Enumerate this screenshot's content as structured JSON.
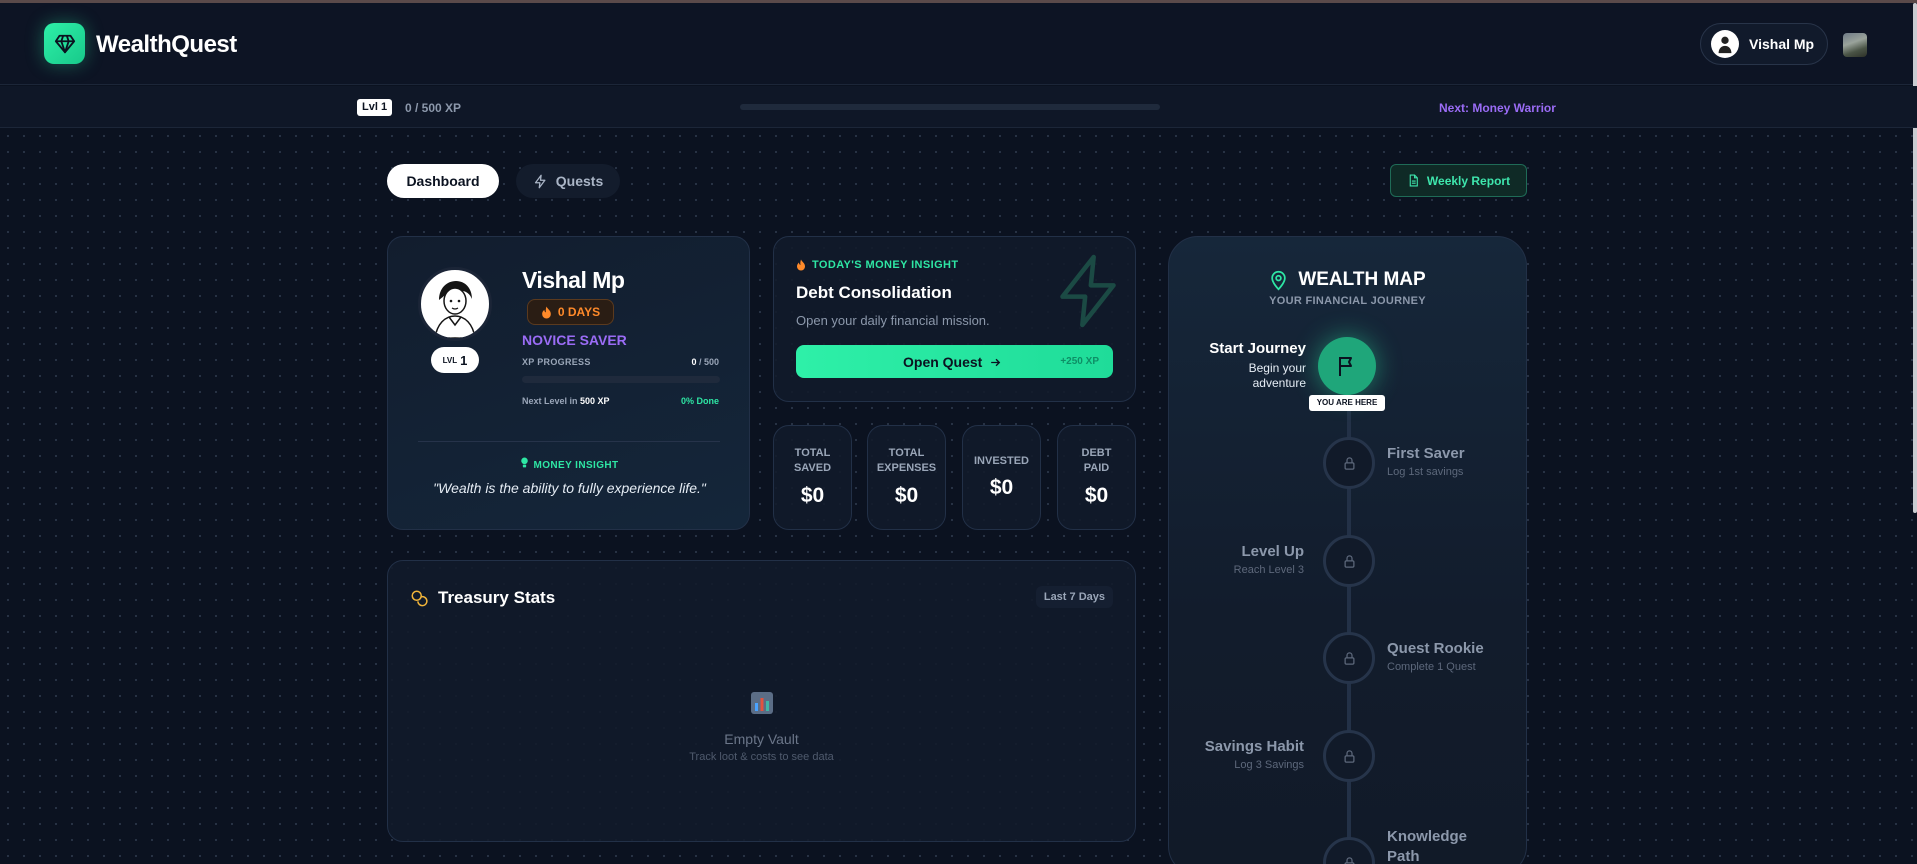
{
  "app": {
    "name": "WealthQuest"
  },
  "header": {
    "user_name": "Vishal Mp"
  },
  "xp_bar": {
    "level_chip": "Lvl 1",
    "xp_text": "0 / 500 XP",
    "progress": 0,
    "next_label": "Next: Money Warrior"
  },
  "tabs": [
    {
      "label": "Dashboard",
      "active": true
    },
    {
      "label": "Quests",
      "active": false
    }
  ],
  "weekly_report_label": "Weekly Report",
  "profile": {
    "name": "Vishal Mp",
    "streak": "0 DAYS",
    "rank": "NOVICE SAVER",
    "level_prefix": "LVL",
    "level": "1",
    "xp_label": "XP PROGRESS",
    "xp_current": "0",
    "xp_total": " / 500",
    "progress": 0,
    "next_level_prefix": "Next Level in ",
    "next_level_xp": "500 XP",
    "done": "0% Done",
    "insight_label": "MONEY INSIGHT",
    "quote": "\"Wealth is the ability to fully experience life.\""
  },
  "insight": {
    "label": "TODAY'S MONEY INSIGHT",
    "title": "Debt Consolidation",
    "subtitle": "Open your daily financial mission.",
    "button": "Open Quest",
    "xp": "+250 XP"
  },
  "stats": [
    {
      "label1": "TOTAL",
      "label2": "SAVED",
      "value": "$0"
    },
    {
      "label1": "TOTAL",
      "label2": "EXPENSES",
      "value": "$0"
    },
    {
      "label1": "INVESTED",
      "label2": "",
      "value": "$0"
    },
    {
      "label1": "DEBT",
      "label2": "PAID",
      "value": "$0"
    }
  ],
  "treasury": {
    "title": "Treasury Stats",
    "range": "Last 7 Days",
    "empty_title": "Empty Vault",
    "empty_sub": "Track loot & costs to see data"
  },
  "wealth_map": {
    "title": "WEALTH MAP",
    "subtitle": "YOUR FINANCIAL JOURNEY",
    "start": {
      "title": "Start Journey",
      "subtitle": "Begin your adventure",
      "tag": "YOU ARE HERE"
    },
    "milestones": [
      {
        "title": "First Saver",
        "subtitle": "Log 1st savings"
      },
      {
        "title": "Level Up",
        "subtitle": "Reach Level 3"
      },
      {
        "title": "Quest Rookie",
        "subtitle": "Complete 1 Quest"
      },
      {
        "title": "Savings Habit",
        "subtitle": "Log 3 Savings"
      },
      {
        "title": "Knowledge Path",
        "subtitle": ""
      }
    ]
  },
  "colors": {
    "accent": "#2ef0a8",
    "purple": "#9b6cf6",
    "orange": "#ff8a2a",
    "background": "#0b1220"
  }
}
